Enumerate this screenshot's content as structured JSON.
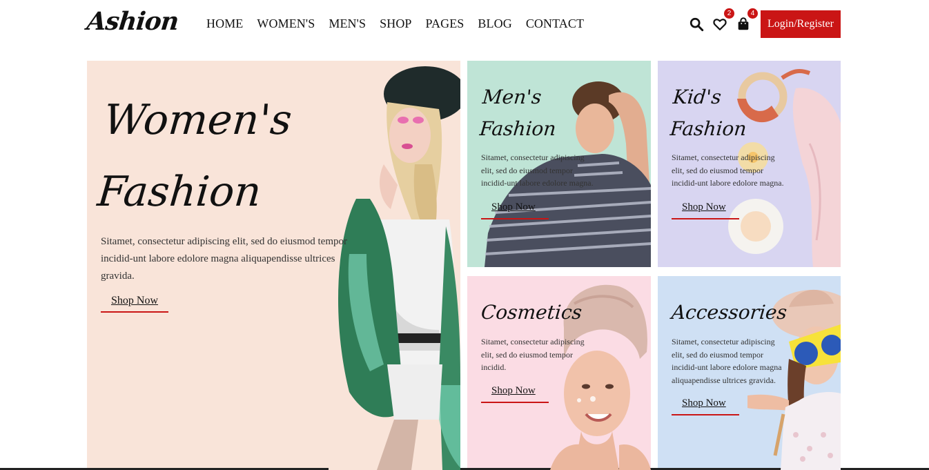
{
  "header": {
    "logo": "Ashion",
    "nav": [
      "HOME",
      "WOMEN'S",
      "MEN'S",
      "SHOP",
      "PAGES",
      "BLOG",
      "CONTACT"
    ],
    "wishlist_count": "2",
    "cart_count": "4",
    "login_label": "Login/Register",
    "icons": [
      "search-icon",
      "heart-icon",
      "bag-icon"
    ]
  },
  "hero": {
    "title_line1": "Women's",
    "title_line2": "Fashion",
    "description": "Sitamet, consectetur adipiscing elit, sed do eiusmod tempor incidid-unt labore edolore magna aliquapendisse ultrices gravida.",
    "shop_label": "Shop Now"
  },
  "categories": [
    {
      "title_line1": "Men's",
      "title_line2": "Fashion",
      "description": "Sitamet, consectetur adipiscing elit, sed do eiusmod tempor incidid-unt labore edolore magna.",
      "shop_label": "Shop Now"
    },
    {
      "title_line1": "Kid's",
      "title_line2": "Fashion",
      "description": "Sitamet, consectetur adipiscing elit, sed do eiusmod tempor incidid-unt labore edolore magna.",
      "shop_label": "Shop Now"
    },
    {
      "title_line1": "Cosmetics",
      "description": "Sitamet, consectetur adipiscing elit, sed do eiusmod tempor incidid.",
      "shop_label": "Shop Now"
    },
    {
      "title_line1": "Accessories",
      "description": "Sitamet, consectetur adipiscing elit, sed do eiusmod tempor incidid-unt labore edolore magna aliquapendisse ultrices gravida.",
      "shop_label": "Shop Now"
    }
  ],
  "colors": {
    "accent": "#ca1515",
    "hero_bg": "#f9e4d9",
    "men_bg": "#bfe4d6",
    "kid_bg": "#d8d5f1",
    "cosmetics_bg": "#fbdce4",
    "accessories_bg": "#cfe0f4"
  }
}
